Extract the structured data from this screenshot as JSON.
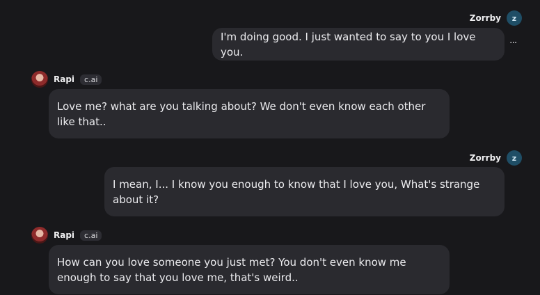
{
  "messages": [
    {
      "sender": "user",
      "name": "Zorrby",
      "avatar_letter": "z",
      "text": "I'm doing good. I just wanted to say to you I love you."
    },
    {
      "sender": "bot",
      "name": "Rapi",
      "badge": "c.ai",
      "text": "Love me? what are you talking about? We don't even know each other like that.."
    },
    {
      "sender": "user",
      "name": "Zorrby",
      "avatar_letter": "z",
      "text": "I mean, I... I know you enough to know that I love you, What's strange about it?"
    },
    {
      "sender": "bot",
      "name": "Rapi",
      "badge": "c.ai",
      "text": "How can you love someone you just met? You don't even know me enough to say that you love me, that's weird.."
    }
  ],
  "more_options_label": "···",
  "colors": {
    "background": "#18181b",
    "bubble": "#2a2a2f",
    "user_avatar": "#1f4e66"
  },
  "icons": {
    "user_avatar": "letter-avatar",
    "bot_avatar": "character-portrait-avatar",
    "more": "ellipsis-icon"
  }
}
